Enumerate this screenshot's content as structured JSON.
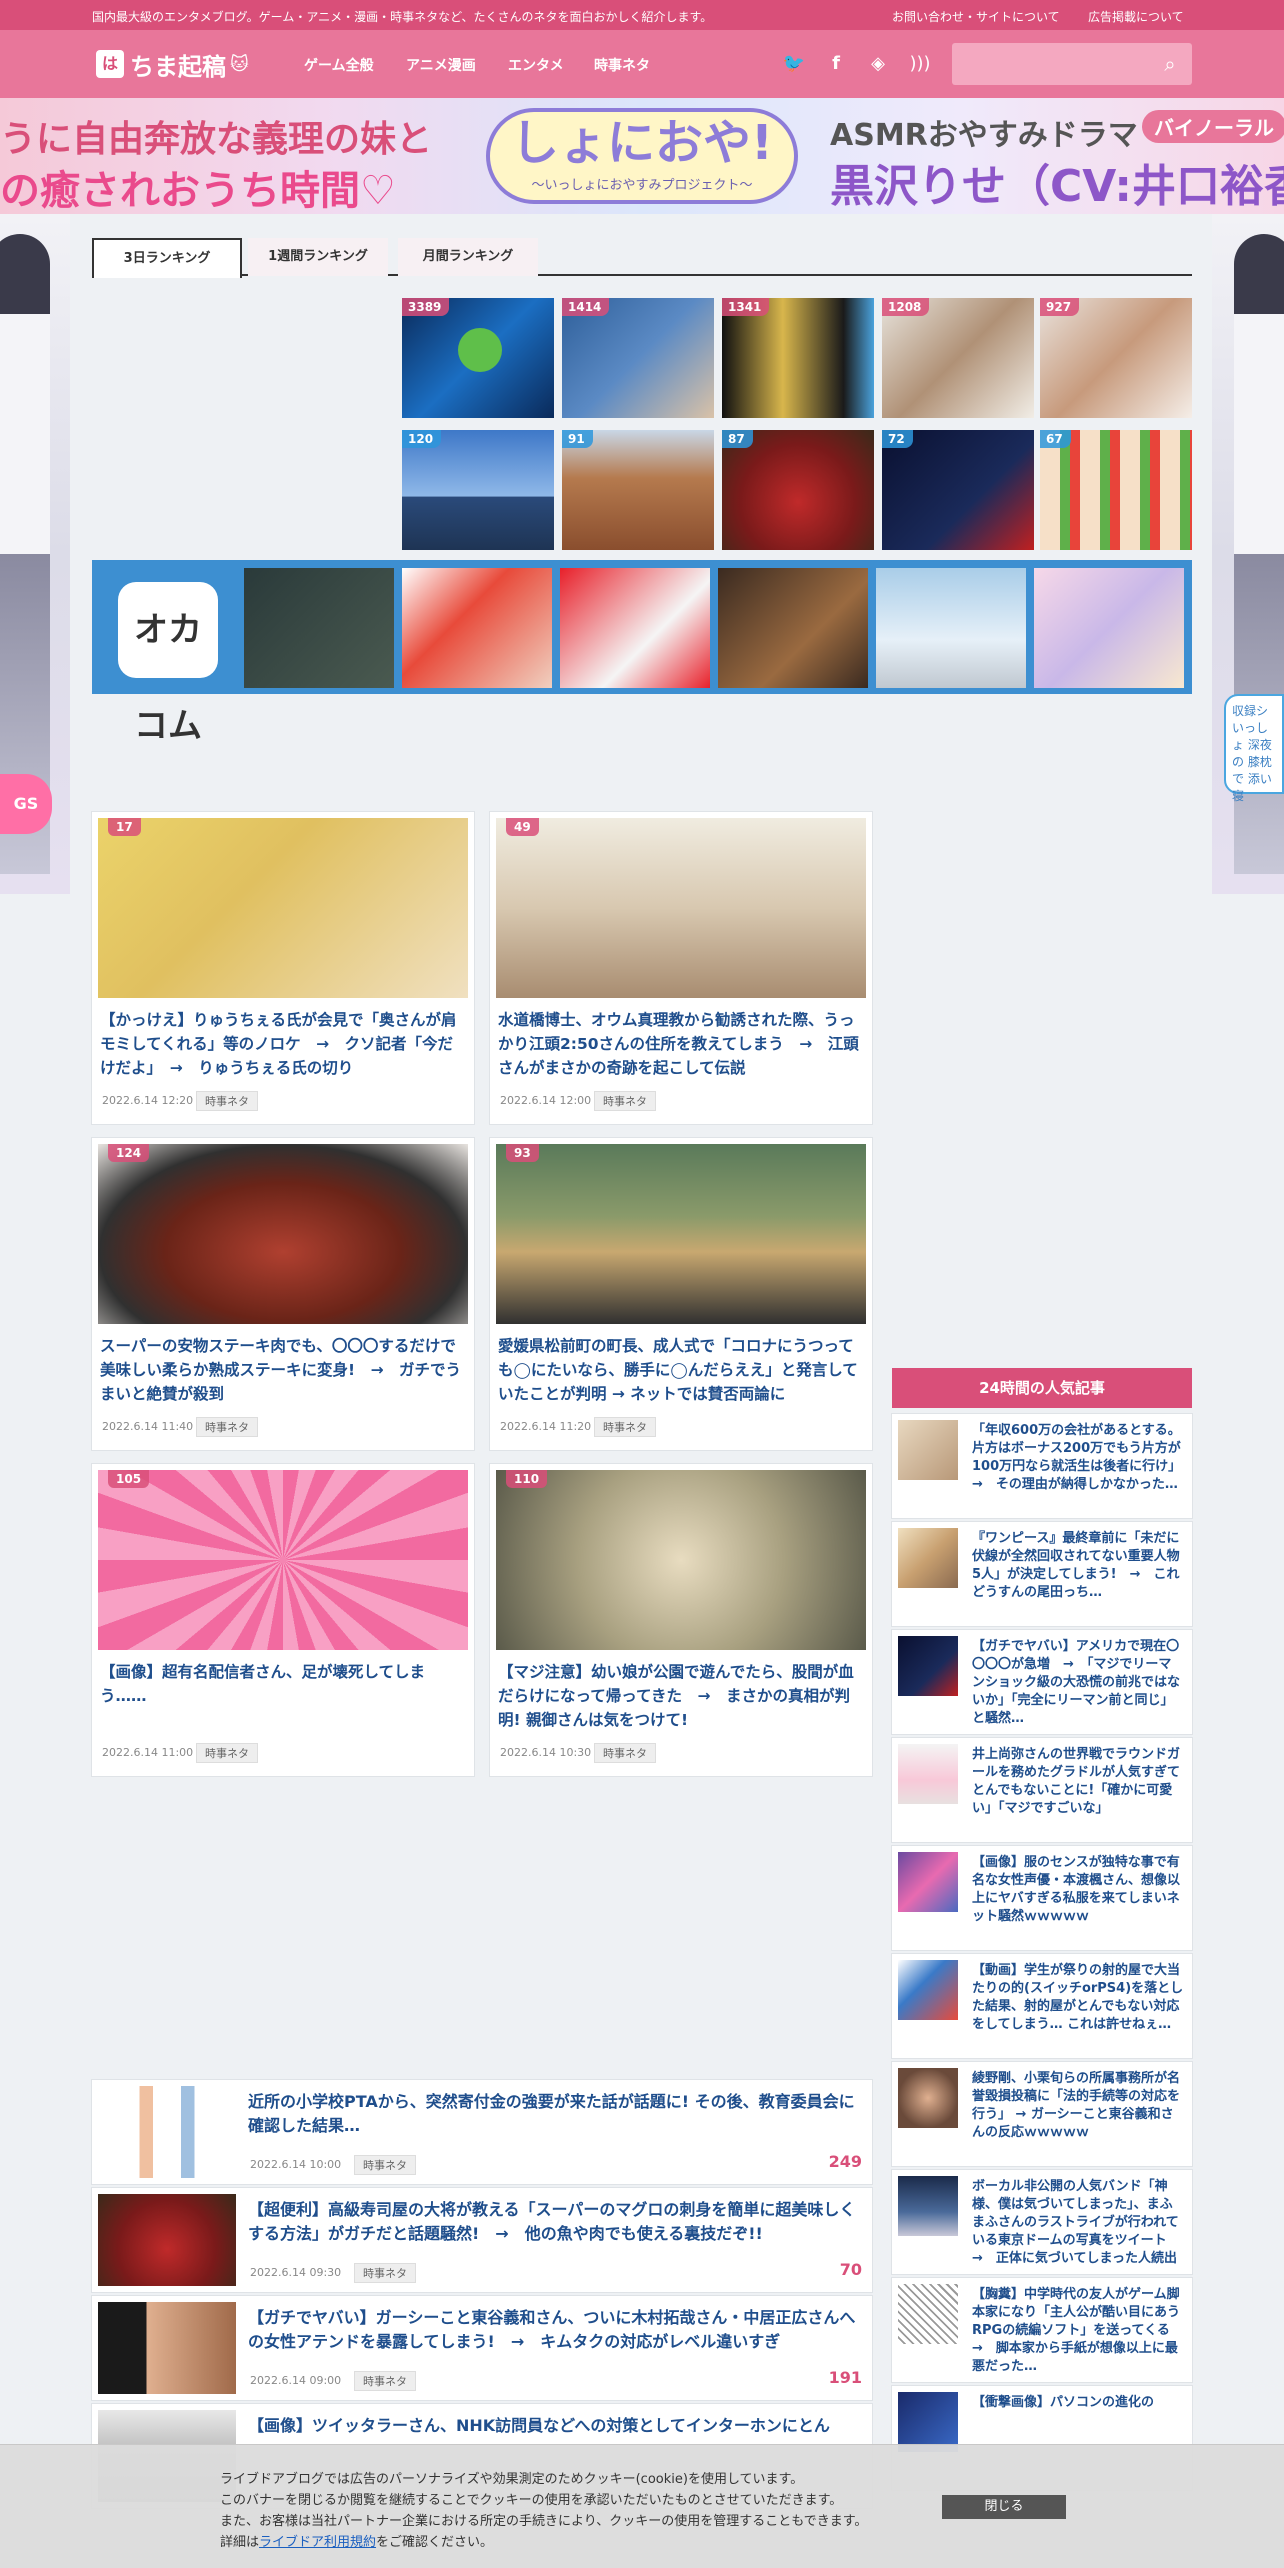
{
  "topbar": {
    "tagline": "国内最大級のエンタメブログ。ゲーム・アニメ・漫画・時事ネタなど、たくさんのネタを面白おかしく紹介します。",
    "links": [
      "お問い合わせ・サイトについて",
      "広告掲載について"
    ]
  },
  "header": {
    "logo_mark": "は",
    "logo_text": "ちま起稿",
    "nav": [
      "ゲーム全般",
      "アニメ漫画",
      "エンタメ",
      "時事ネタ"
    ],
    "search_placeholder": ""
  },
  "banner": {
    "line1": "うに自由奔放な義理の妹と",
    "line2": "の癒されおうち時間♡",
    "center_title": "しょにおや!",
    "center_sub": "〜いっしょにおやすみプロジェクト〜",
    "right1": "ASMRおやすみドラマ",
    "right_badge": "バイノーラル",
    "right2": "黒沢りせ（CV:井口裕香"
  },
  "side_right_text": "収録シ いっしょ 深夜の 膝枕で 添い寝",
  "side_left_text": "GS",
  "ranking": {
    "tabs": [
      "3日ランキング",
      "1週間ランキング",
      "月間ランキング"
    ],
    "row1": [
      3389,
      1414,
      1341,
      1208,
      927
    ],
    "row2": [
      120,
      91,
      87,
      72,
      67
    ]
  },
  "okazu_logo": "オカコム",
  "cards": [
    {
      "count": "17",
      "title": "【かっけえ】りゅうちぇる氏が会見で「奥さんが肩モミしてくれる」等のノロケ　→　クソ記者「今だけだよ」　→　りゅうちぇる氏の切り",
      "date": "2022.6.14 12:20",
      "tag": "時事ネタ"
    },
    {
      "count": "49",
      "title": "水道橋博士、オウム真理教から勧誘された際、うっかり江頭2:50さんの住所を教えてしまう　→　江頭さんがまさかの奇跡を起こして伝説",
      "date": "2022.6.14 12:00",
      "tag": "時事ネタ"
    },
    {
      "count": "124",
      "title": "スーパーの安物ステーキ肉でも、〇〇〇するだけで美味しい柔らか熟成ステーキに変身!　→　ガチでうまいと絶賛が殺到",
      "date": "2022.6.14 11:40",
      "tag": "時事ネタ"
    },
    {
      "count": "93",
      "title": "愛媛県松前町の町長、成人式で「コロナにうつっても◯にたいなら、勝手に◯んだらええ」と発言していたことが判明 → ネットでは賛否両論に",
      "date": "2022.6.14 11:20",
      "tag": "時事ネタ"
    },
    {
      "count": "105",
      "title": "【画像】超有名配信者さん、足が壊死してしまう……",
      "date": "2022.6.14 11:00",
      "tag": "時事ネタ"
    },
    {
      "count": "110",
      "title": "【マジ注意】幼い娘が公園で遊んでたら、股間が血だらけになって帰ってきた　→　まさかの真相が判明! 親御さんは気をつけて!",
      "date": "2022.6.14 10:30",
      "tag": "時事ネタ"
    }
  ],
  "sidebar": {
    "heading": "24時間の人気記事",
    "items": [
      "「年収600万の会社があるとする。片方はボーナス200万でもう片方が100万円なら就活生は後者に行け」　→　その理由が納得しかなかった…",
      "『ワンピース』最終章前に「未だに伏線が全然回収されてない重要人物5人」が決定してしまう!　→　これどうすんの尾田っち…",
      "【ガチでヤバい】アメリカで現在〇〇〇〇が急増　→　「マジでリーマンショック級の大恐慌の前兆ではないか」「完全にリーマン前と同じ」と騒然…",
      "井上尚弥さんの世界戦でラウンドガールを務めたグラドルが人気すぎてとんでもないことに!「確かに可愛い」「マジですごいな」",
      "【画像】服のセンスが独特な事で有名な女性声優・本渡楓さん、想像以上にヤバすぎる私服を来てしまいネット騒然ｗｗｗｗｗ",
      "【動画】学生が祭りの射的屋で大当たりの的(スイッチorPS4)を落とした結果、射的屋がとんでもない対応をしてしまう… これは許せねぇ…",
      "綾野剛、小栗旬らの所属事務所が名誉毀損投稿に「法的手続等の対応を行う」 → ガーシーこと東谷義和さんの反応ｗｗｗｗｗ",
      "ボーカル非公開の人気バンド「神様、僕は気づいてしまった」、まふまふさんのラストライブが行われている東京ドームの写真をツイート　→　正体に気づいてしまった人続出",
      "【胸糞】中学時代の友人がゲーム脚本家になり「主人公が酷い目にあうRPGの続編ソフト」を送ってくる　→　脚本家から手紙が想像以上に最悪だった…",
      "【衝撃画像】パソコンの進化の"
    ]
  },
  "list": [
    {
      "title": "近所の小学校PTAから、突然寄付金の強要が来た話が話題に! その後、教育委員会に確認した結果…",
      "date": "2022.6.14 10:00",
      "tag": "時事ネタ",
      "count": "249"
    },
    {
      "title": "【超便利】高級寿司屋の大将が教える「スーパーのマグロの刺身を簡単に超美味しくする方法」がガチだと話題騒然!　→　他の魚や肉でも使える裏技だぞ!!",
      "date": "2022.6.14 09:30",
      "tag": "時事ネタ",
      "count": "70"
    },
    {
      "title": "【ガチでヤバい】ガーシーこと東谷義和さん、ついに木村拓哉さん・中居正広さんへの女性アテンドを暴露してしまう!　→　キムタクの対応がレベル違いすぎ",
      "date": "2022.6.14 09:00",
      "tag": "時事ネタ",
      "count": "191"
    },
    {
      "title": "【画像】ツイッタラーさん、NHK訪問員などへの対策としてインターホンにとん",
      "date": "",
      "tag": "",
      "count": ""
    }
  ],
  "cookie": {
    "lines": [
      "ライブドアブログでは広告のパーソナライズや効果測定のためクッキー(cookie)を使用しています。",
      "このバナーを閉じるか閲覧を継続することでクッキーの使用を承認いただいたものとさせていただきます。",
      "また、お客様は当社パートナー企業における所定の手続きにより、クッキーの使用を管理することもできます。"
    ],
    "line4_pre": "詳細は",
    "link": "ライブドア利用規約",
    "line4_post": "をご確認ください。",
    "close": "閉じる"
  },
  "colors": {
    "brand": "#d94f79",
    "brand_light": "#e8769a",
    "link": "#1f4e8c",
    "okazu": "#3d8fd1"
  }
}
